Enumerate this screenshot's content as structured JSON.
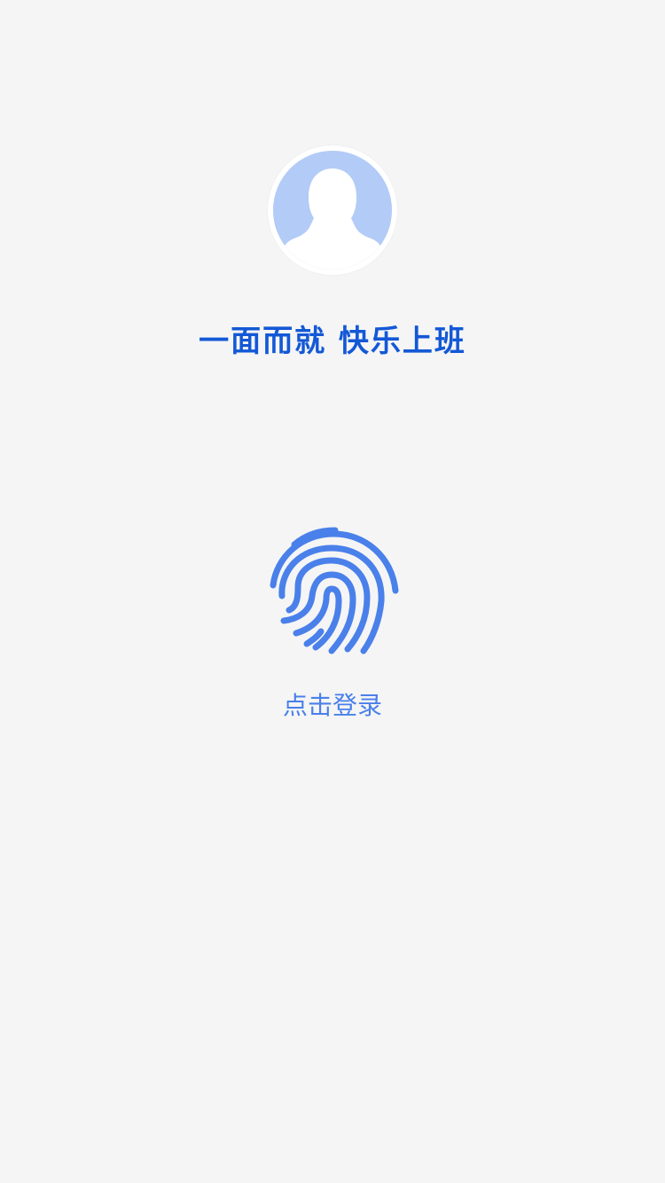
{
  "avatar": {
    "icon": "user-silhouette-icon",
    "background_color": "#b3cbf7"
  },
  "slogan": {
    "text": "一面而就  快乐上班",
    "color": "#1358d6"
  },
  "login": {
    "icon": "fingerprint-icon",
    "label": "点击登录",
    "color": "#4a80ea"
  },
  "page": {
    "background_color": "#f5f5f5"
  }
}
